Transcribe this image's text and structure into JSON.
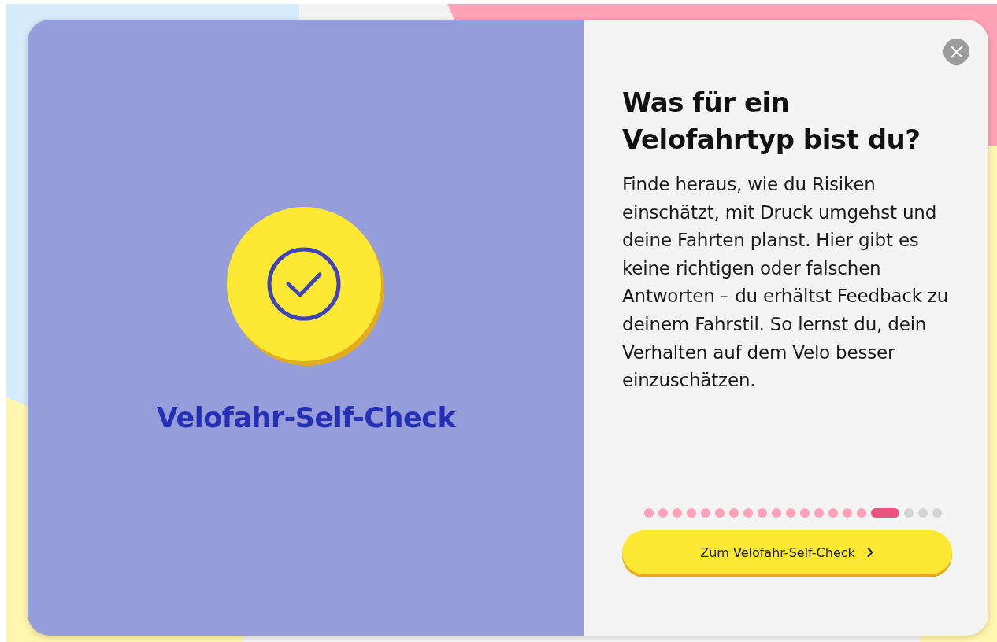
{
  "hero": {
    "title": "Velofahr-Self-Check"
  },
  "heading": "Was für ein Velofahrtyp bist du?",
  "description": "Finde heraus, wie du Risiken einschätzt, mit Druck umgehst und deine Fahrten planst. Hier gibt es keine richtigen oder falschen Antworten – du erhältst Feedback zu deinem Fahrstil. So lernst du, dein Verhalten auf dem Velo besser einzuschätzen.",
  "progress": [
    {
      "kind": "done"
    },
    {
      "kind": "done"
    },
    {
      "kind": "done"
    },
    {
      "kind": "done"
    },
    {
      "kind": "done"
    },
    {
      "kind": "done"
    },
    {
      "kind": "done"
    },
    {
      "kind": "done"
    },
    {
      "kind": "done"
    },
    {
      "kind": "done"
    },
    {
      "kind": "done"
    },
    {
      "kind": "done"
    },
    {
      "kind": "done"
    },
    {
      "kind": "done"
    },
    {
      "kind": "done"
    },
    {
      "kind": "done"
    },
    {
      "kind": "current"
    },
    {
      "kind": "upcoming"
    },
    {
      "kind": "upcoming"
    },
    {
      "kind": "upcoming"
    }
  ],
  "button": {
    "label": "Zum Velofahr-Self-Check"
  }
}
